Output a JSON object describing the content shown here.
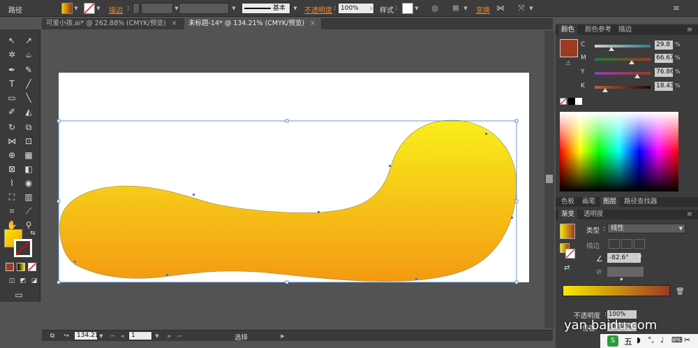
{
  "control_bar": {
    "path_label": "路径",
    "stroke_label": "描边",
    "style_preset": "基本",
    "opacity_label": "不透明度",
    "opacity_value": "100%",
    "style_label": "样式",
    "transform_label": "变换"
  },
  "tabs": [
    {
      "label": "可爱小孩.ai* @ 262.88% (CMYK/预览)",
      "close": "×",
      "active": false
    },
    {
      "label": "未标题-14* @ 134.21% (CMYK/预览)",
      "close": "×",
      "active": true
    }
  ],
  "status": {
    "zoom": "134.21",
    "page": "1",
    "mode": "选择"
  },
  "color_panel": {
    "tabs": [
      "颜色",
      "颜色参考",
      "描边"
    ],
    "fill_color": "#9b3b22",
    "channels": [
      {
        "name": "C",
        "value": "29.8",
        "percent": 29.8,
        "bar": "linear-gradient(to right,#d4d0c8,#2e7d89)"
      },
      {
        "name": "M",
        "value": "66.67",
        "percent": 66.67,
        "bar": "linear-gradient(to right,#1f7c3a,#9b3b22)"
      },
      {
        "name": "Y",
        "value": "76.86",
        "percent": 76.86,
        "bar": "linear-gradient(to right,#8b3fb0,#9b3b22)"
      },
      {
        "name": "K",
        "value": "18.43",
        "percent": 18.43,
        "bar": "linear-gradient(to right,#c06040,#1a0a05)"
      }
    ],
    "percent_sign": "%"
  },
  "lower_tabs": [
    "色板",
    "画笔",
    "图层",
    "路径查找器"
  ],
  "gradient_panel": {
    "tabs": [
      "渐变",
      "透明度"
    ],
    "type_label": "类型",
    "type_value": "线性",
    "stroke_label": "描边",
    "angle_value": "-82.6°",
    "opacity_label": "不透明度",
    "opacity_value": "100%",
    "location_label": "位置",
    "location_value": "76.84%"
  },
  "watermark": "yan.baidu.com",
  "taskbar_ime": "五",
  "shape_gradient": {
    "top": "#f8ef1c",
    "bottom": "#f49a12"
  }
}
